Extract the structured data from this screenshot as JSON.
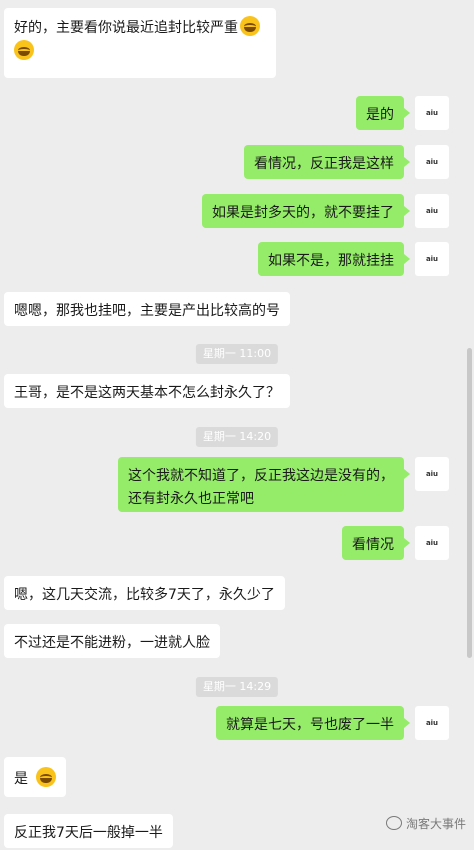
{
  "messages": [
    {
      "side": "left",
      "text": "好的，主要看你说最近追封比较严重",
      "emoji": "laugh-cry"
    },
    {
      "side": "right",
      "text": "是的",
      "avatar": "avatar"
    },
    {
      "side": "right",
      "text": "看情况，反正我是这样",
      "avatar": "avatar"
    },
    {
      "side": "right",
      "text": "如果是封多天的，就不要挂了",
      "avatar": "avatar"
    },
    {
      "side": "right",
      "text": "如果不是，那就挂挂",
      "avatar": "avatar"
    },
    {
      "side": "left",
      "text": "嗯嗯，那我也挂吧，主要是产出比较高的号"
    },
    {
      "side": "left",
      "text": "王哥，是不是这两天基本不怎么封永久了？"
    },
    {
      "side": "right",
      "text": "这个我就不知道了，反正我这边是没有的，",
      "text2": "还有封永久也正常吧"
    },
    {
      "side": "right",
      "text": "看情况"
    },
    {
      "side": "left",
      "text": "嗯，这几天交流，比较多7天了，永久少了"
    },
    {
      "side": "left",
      "text": "不过还是不能进粉，一进就人脸"
    },
    {
      "side": "right",
      "text": "就算是七天，号也废了一半"
    },
    {
      "side": "left",
      "text": "是",
      "emoji": "laugh-cry"
    },
    {
      "side": "left",
      "text": "反正我7天后一般掉一半"
    }
  ],
  "timestamps": [
    "星期一 11:00",
    "星期一 14:20",
    "星期一 14:29"
  ],
  "watermark": "淘客大事件"
}
